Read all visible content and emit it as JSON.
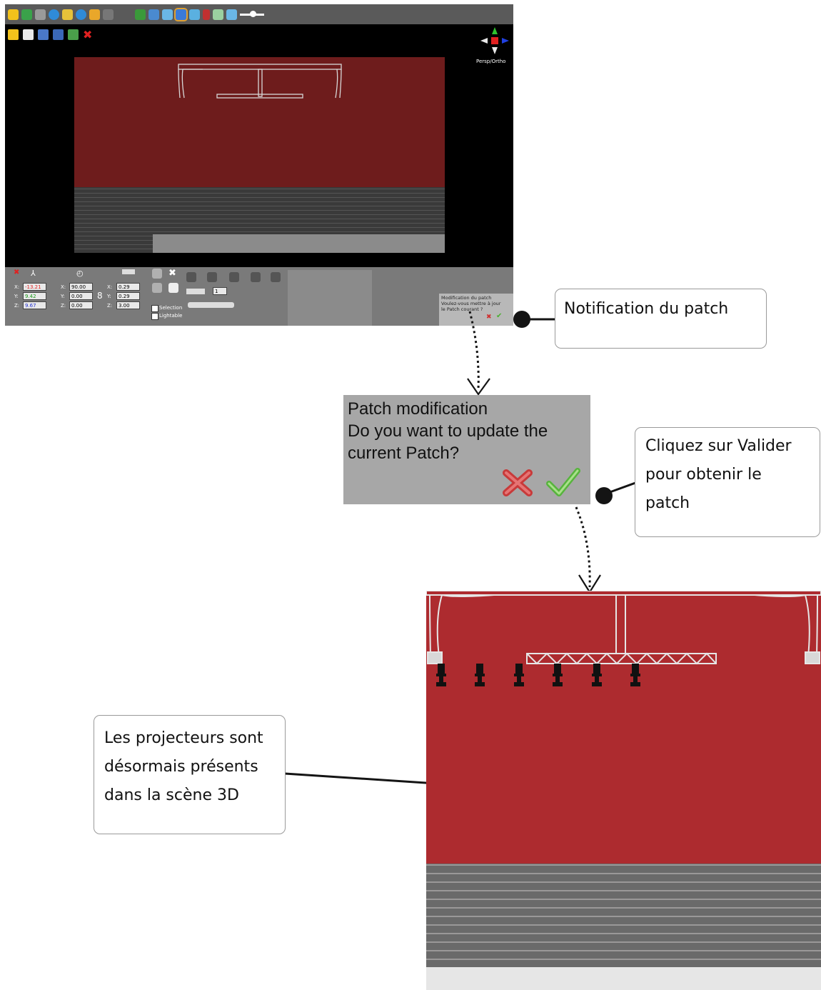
{
  "app": {
    "view_mode_label": "Persp/Ortho",
    "transform": {
      "position": {
        "x": "-13.21",
        "y": "9.42",
        "z": "9.67"
      },
      "rotation": {
        "x": "90.00",
        "y": "0.00",
        "z": "0.00"
      },
      "scale": {
        "x": "0.29",
        "y": "0.29",
        "z": "3.00"
      },
      "axis_labels": {
        "x": "X:",
        "y": "Y:",
        "z": "Z:"
      },
      "count_value": "1"
    },
    "checkboxes": {
      "selection": "Selection",
      "lightable": "Lightable"
    },
    "notification_small": {
      "line1": "Modification du patch",
      "line2": "Voulez-vous mettre à jour",
      "line3": "le Patch courant ?"
    },
    "colors": {
      "toolbar": "#5a5a5a",
      "stage_backdrop": "#6e1c1c",
      "panel": "#7a7a7a"
    }
  },
  "callouts": {
    "notification": "Notification du patch",
    "validate": [
      "Cliquez sur Valider",
      "pour obtenir le",
      "patch"
    ],
    "projectors": [
      "Les projecteurs sont",
      "désormais présents",
      "dans la scène 3D"
    ]
  },
  "dialog": {
    "title": "Patch modification",
    "line2": "Do you want to update the",
    "line3": "current Patch?",
    "cancel_icon": "red-cross-icon",
    "confirm_icon": "green-check-icon"
  },
  "scene": {
    "backdrop_color": "#ad2b2f",
    "projector_count": 6
  }
}
